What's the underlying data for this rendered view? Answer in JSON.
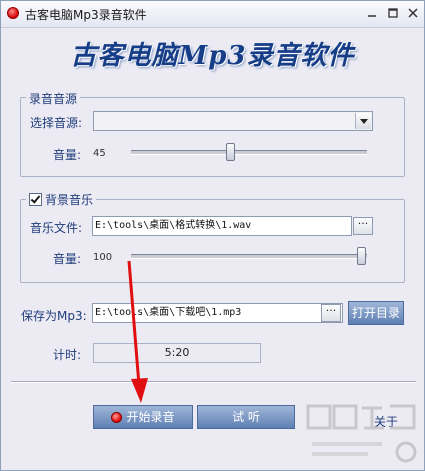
{
  "window": {
    "title": "古客电脑Mp3录音软件"
  },
  "banner": {
    "text": "古客电脑Mp3录音软件"
  },
  "record_source": {
    "group_label": "录音音源",
    "select_label": "选择音源:",
    "selected_value": "",
    "volume_label": "音量:",
    "volume_value": "45"
  },
  "background_music": {
    "group_label": "背景音乐",
    "enabled": true,
    "file_label": "音乐文件:",
    "file_path": "E:\\tools\\桌面\\格式转换\\1.wav",
    "browse_label": "···",
    "volume_label": "音量:",
    "volume_value": "100"
  },
  "save": {
    "label": "保存为Mp3:",
    "path": "E:\\tools\\桌面\\下载吧\\1.mp3",
    "browse_label": "···",
    "open_dir_label": "打开目录"
  },
  "timer": {
    "label": "计时:",
    "value": "5:20"
  },
  "actions": {
    "start_label": "开始录音",
    "listen_label": "试  听",
    "about_label": "关于"
  },
  "colors": {
    "accent": "#163d87",
    "button": "#6f8dc0",
    "record": "#e00000"
  }
}
